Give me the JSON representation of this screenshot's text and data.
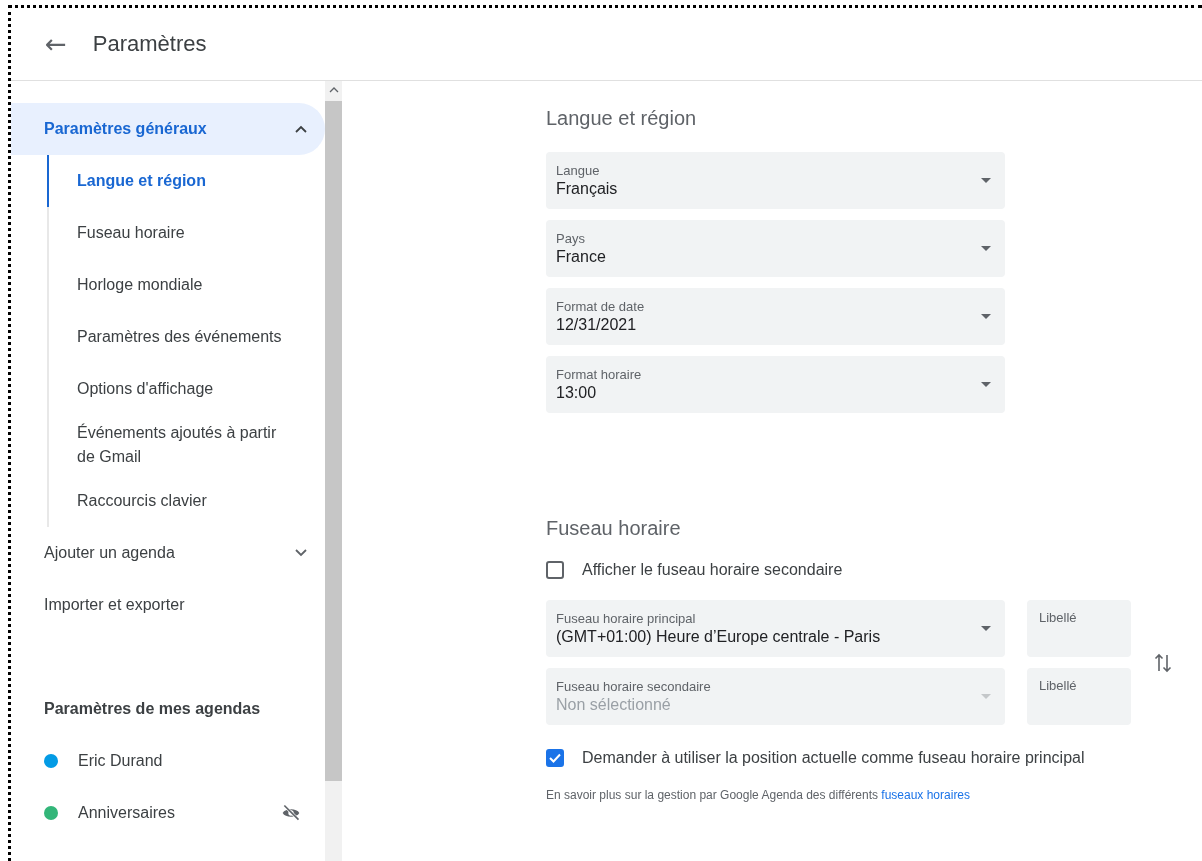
{
  "header": {
    "back_icon": "←",
    "title": "Paramètres"
  },
  "sidebar": {
    "items": [
      {
        "label": "Paramètres généraux",
        "expanded": true,
        "children": [
          {
            "label": "Langue et région",
            "selected": true
          },
          {
            "label": "Fuseau horaire",
            "selected": false
          },
          {
            "label": "Horloge mondiale",
            "selected": false
          },
          {
            "label": "Paramètres des événements",
            "selected": false
          },
          {
            "label": "Options d'affichage",
            "selected": false
          },
          {
            "label": "Événements ajoutés à partir de Gmail",
            "selected": false
          },
          {
            "label": "Raccourcis clavier",
            "selected": false
          }
        ]
      },
      {
        "label": "Ajouter un agenda",
        "expanded": false
      },
      {
        "label": "Importer et exporter"
      }
    ],
    "calendars_heading": "Paramètres de mes agendas",
    "calendars": [
      {
        "name": "Eric Durand",
        "color": "#039be5",
        "hidden": false
      },
      {
        "name": "Anniversaires",
        "color": "#33b679",
        "hidden": true
      }
    ]
  },
  "language_section": {
    "title": "Langue et région",
    "fields": [
      {
        "label": "Langue",
        "value": "Français"
      },
      {
        "label": "Pays",
        "value": "France"
      },
      {
        "label": "Format de date",
        "value": "12/31/2021"
      },
      {
        "label": "Format horaire",
        "value": "13:00"
      }
    ]
  },
  "timezone_section": {
    "title": "Fuseau horaire",
    "show_secondary": {
      "label": "Afficher le fuseau horaire secondaire",
      "checked": false
    },
    "zones": [
      {
        "label": "Fuseau horaire principal",
        "value": "(GMT+01:00) Heure d’Europe centrale - Paris",
        "disabled": false,
        "name_label": "Libellé"
      },
      {
        "label": "Fuseau horaire secondaire",
        "value": "Non sélectionné",
        "disabled": true,
        "name_label": "Libellé"
      }
    ],
    "use_location": {
      "label": "Demander à utiliser la position actuelle comme fuseau horaire principal",
      "checked": true
    },
    "footer": "En savoir plus sur la gestion par Google Agenda des différents",
    "footer_link": "fuseaux horaires"
  }
}
